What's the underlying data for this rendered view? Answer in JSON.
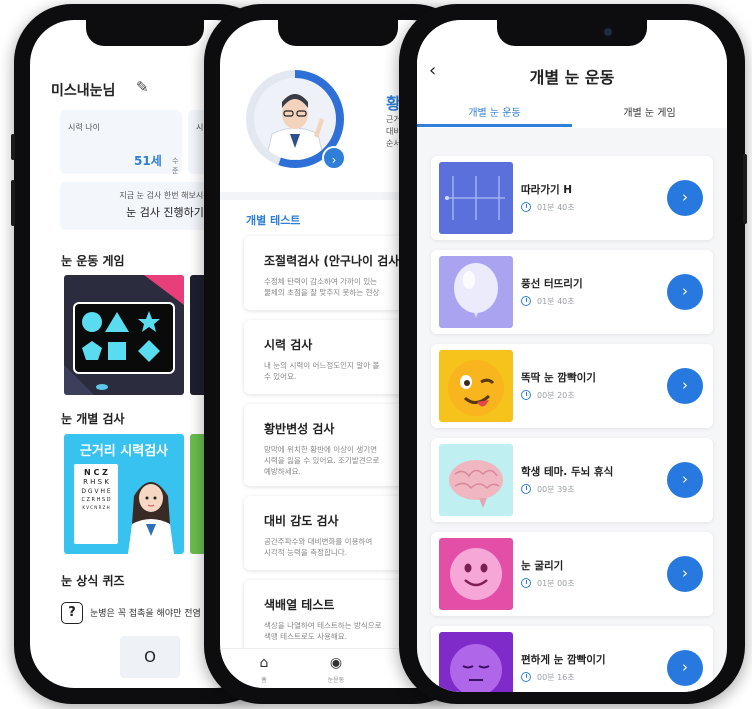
{
  "phone1": {
    "user_name": "미스내눈님",
    "edit_icon": "pencil-icon",
    "eye_age_label": "시력 나이",
    "eye_age_value": "51세",
    "eye_age_unit": "수준",
    "second_card_label": "시",
    "banner_sub": "지금 눈 검사 한번 해보시는",
    "banner_title": "눈 검사 진행하기",
    "section_game": "눈 운동 게임",
    "section_test": "눈 개별 검사",
    "near_vision_title": "근거리 시력검사",
    "chart_lines": [
      "N C Z",
      "R H S K",
      "D G V H E",
      "C Z R H S D",
      "K V C N R Z H"
    ],
    "section_quiz": "눈 상식 퀴즈",
    "quiz_mark": "?",
    "quiz_text": "눈병은 꼭 접촉을 해야만 전염",
    "answer_o": "O"
  },
  "phone2": {
    "header_title": "황",
    "header_desc": [
      "근거",
      "대비",
      "순서"
    ],
    "section_label": "개별 테스트",
    "cards": [
      {
        "title": "조절력검사 (안구나이 검사)",
        "desc": [
          "수정체 탄력이 감소하여 가까이 있는",
          "물체의 초점을 잘 맞추지 못하는 현상"
        ]
      },
      {
        "title": "시력 검사",
        "desc": [
          "내 눈의 시력이 어느정도인지 알아 볼",
          "수 있어요."
        ]
      },
      {
        "title": "황반변성 검사",
        "desc": [
          "망막에 위치한 황반에 이상이 생기면",
          "시력을 잃을 수 있어요. 조기발견으로",
          "예방하세요."
        ]
      },
      {
        "title": "대비 감도 검사",
        "desc": [
          "공간주파수와 대비변화를 이용하여",
          "시각적 능력을 측정합니다."
        ]
      },
      {
        "title": "색배열 테스트",
        "desc": [
          "색상을 나열하여 테스트하는 방식으로",
          "색맹 테스트로도 사용해요."
        ]
      }
    ],
    "tabs": [
      {
        "icon": "home-icon",
        "label": "홈"
      },
      {
        "icon": "eye-icon",
        "label": "눈운동"
      }
    ]
  },
  "phone3": {
    "title": "개별 눈 운동",
    "tab_active": "개별 눈 운동",
    "tab_inactive": "개별 눈 게임",
    "exercises": [
      {
        "name": "따라가기 H",
        "duration": "01분 40초"
      },
      {
        "name": "풍선 터뜨리기",
        "duration": "01분 40초"
      },
      {
        "name": "똑딱 눈 깜빡이기",
        "duration": "00분 20초"
      },
      {
        "name": "학생 테마. 두뇌 휴식",
        "duration": "00분 39초"
      },
      {
        "name": "눈 굴리기",
        "duration": "01분 00초"
      },
      {
        "name": "편하게 눈 깜빡이기",
        "duration": "00분 16초"
      }
    ]
  },
  "colors": {
    "accent": "#2f7fd8",
    "button": "#2779df"
  }
}
